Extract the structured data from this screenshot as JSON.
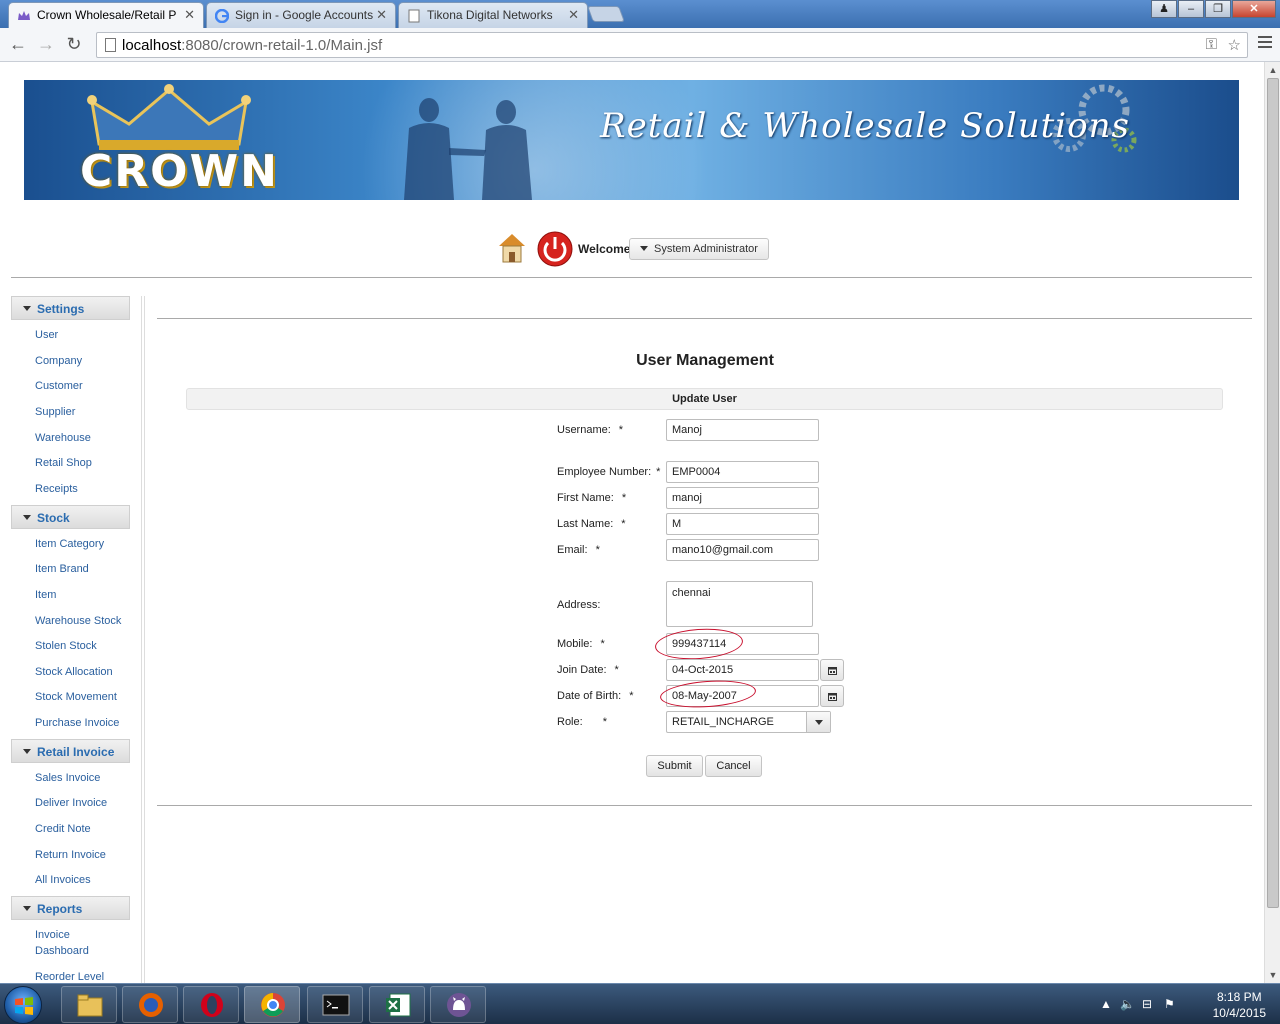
{
  "browser": {
    "tabs": [
      {
        "title": "Crown Wholesale/Retail P",
        "active": true
      },
      {
        "title": "Sign in - Google Accounts",
        "active": false
      },
      {
        "title": "Tikona Digital Networks",
        "active": false
      }
    ],
    "url_host": "localhost",
    "url_path": ":8080/crown-retail-1.0/Main.jsf",
    "window_controls": [
      "minimize-icon",
      "restore-icon",
      "close-icon"
    ]
  },
  "banner": {
    "logo_text": "CROWN",
    "tagline": "Retail & Wholesale Solutions"
  },
  "header": {
    "welcome": "Welcome",
    "user_menu": "System Administrator"
  },
  "sidebar": {
    "sections": [
      {
        "title": "Settings",
        "items": [
          "User",
          "Company",
          "Customer",
          "Supplier",
          "Warehouse",
          "Retail Shop",
          "Receipts"
        ]
      },
      {
        "title": "Stock",
        "items": [
          "Item Category",
          "Item Brand",
          "Item",
          "Warehouse Stock",
          "Stolen Stock",
          "Stock Allocation",
          "Stock Movement",
          "Purchase Invoice"
        ]
      },
      {
        "title": "Retail Invoice",
        "items": [
          "Sales Invoice",
          "Deliver Invoice",
          "Credit Note",
          "Return Invoice",
          "All Invoices"
        ]
      },
      {
        "title": "Reports",
        "items": [
          "Invoice Dashboard",
          "Reorder Level"
        ]
      }
    ]
  },
  "form": {
    "title": "User Management",
    "subtitle": "Update User",
    "required_mark": "*",
    "fields": {
      "username": {
        "label": "Username:",
        "value": "Manoj"
      },
      "employee_number": {
        "label": "Employee Number:",
        "value": "EMP0004"
      },
      "first_name": {
        "label": "First Name:",
        "value": "manoj"
      },
      "last_name": {
        "label": "Last Name:",
        "value": "M"
      },
      "email": {
        "label": "Email:",
        "value": "mano10@gmail.com"
      },
      "address": {
        "label": "Address:",
        "value": "chennai"
      },
      "mobile": {
        "label": "Mobile:",
        "value": "999437114"
      },
      "join_date": {
        "label": "Join Date:",
        "value": "04-Oct-2015"
      },
      "date_of_birth": {
        "label": "Date of Birth:",
        "value": "08-May-2007"
      },
      "role": {
        "label": "Role:",
        "value": "RETAIL_INCHARGE"
      }
    },
    "submit_label": "Submit",
    "cancel_label": "Cancel"
  },
  "taskbar": {
    "apps": [
      "file-explorer-icon",
      "firefox-icon",
      "opera-icon",
      "chrome-icon",
      "command-prompt-icon",
      "excel-icon",
      "github-icon"
    ],
    "time": "8:18 PM",
    "date": "10/4/2015"
  },
  "colors": {
    "link": "#2a5f9e",
    "annotation_circle": "#c8102e",
    "banner_blue": "#3c86c9"
  }
}
